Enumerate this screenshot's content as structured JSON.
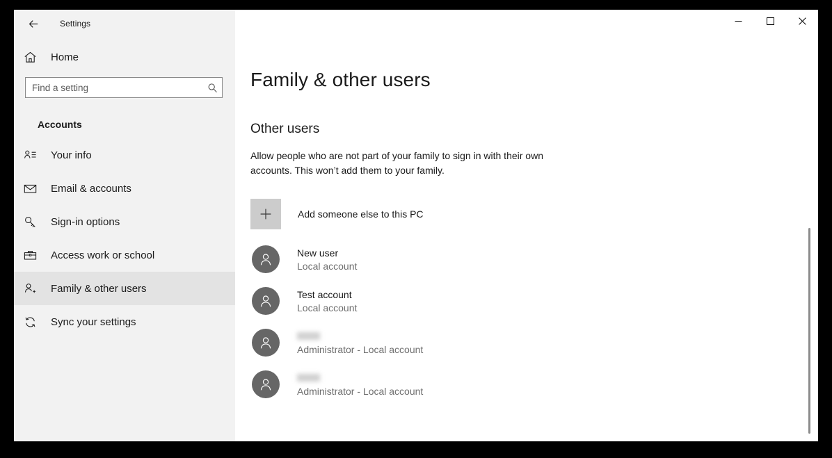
{
  "window": {
    "title": "Settings",
    "back_icon": "back-arrow-icon",
    "controls": {
      "minimize": "–",
      "maximize": "☐",
      "close": "✕"
    }
  },
  "sidebar": {
    "home": {
      "label": "Home",
      "icon": "home-icon"
    },
    "search": {
      "placeholder": "Find a setting",
      "value": "",
      "icon": "search-icon"
    },
    "section_title": "Accounts",
    "items": [
      {
        "label": "Your info",
        "icon": "user-info-icon",
        "selected": false
      },
      {
        "label": "Email & accounts",
        "icon": "envelope-icon",
        "selected": false
      },
      {
        "label": "Sign-in options",
        "icon": "key-icon",
        "selected": false
      },
      {
        "label": "Access work or school",
        "icon": "briefcase-icon",
        "selected": false
      },
      {
        "label": "Family & other users",
        "icon": "person-add-icon",
        "selected": true
      },
      {
        "label": "Sync your settings",
        "icon": "sync-icon",
        "selected": false
      }
    ]
  },
  "main": {
    "page_title": "Family & other users",
    "group_heading": "Other users",
    "group_description": "Allow people who are not part of your family to sign in with their own accounts. This won’t add them to your family.",
    "add_user": {
      "label": "Add someone else to this PC",
      "icon": "plus-icon"
    },
    "users": [
      {
        "name": "New user",
        "redacted": false,
        "account_type": "Local account"
      },
      {
        "name": "Test account",
        "redacted": false,
        "account_type": "Local account"
      },
      {
        "name": "",
        "redacted": true,
        "account_type": "Administrator - Local account"
      },
      {
        "name": "",
        "redacted": true,
        "account_type": "Administrator - Local account"
      }
    ]
  },
  "colors": {
    "sidebar_bg": "#f2f2f2",
    "content_bg": "#ffffff",
    "avatar_bg": "#666666",
    "selection_bar": "#4a4a4a",
    "add_button_bg": "#cccccc",
    "text_primary": "#1a1a1a",
    "text_secondary": "#6e6e6e"
  }
}
